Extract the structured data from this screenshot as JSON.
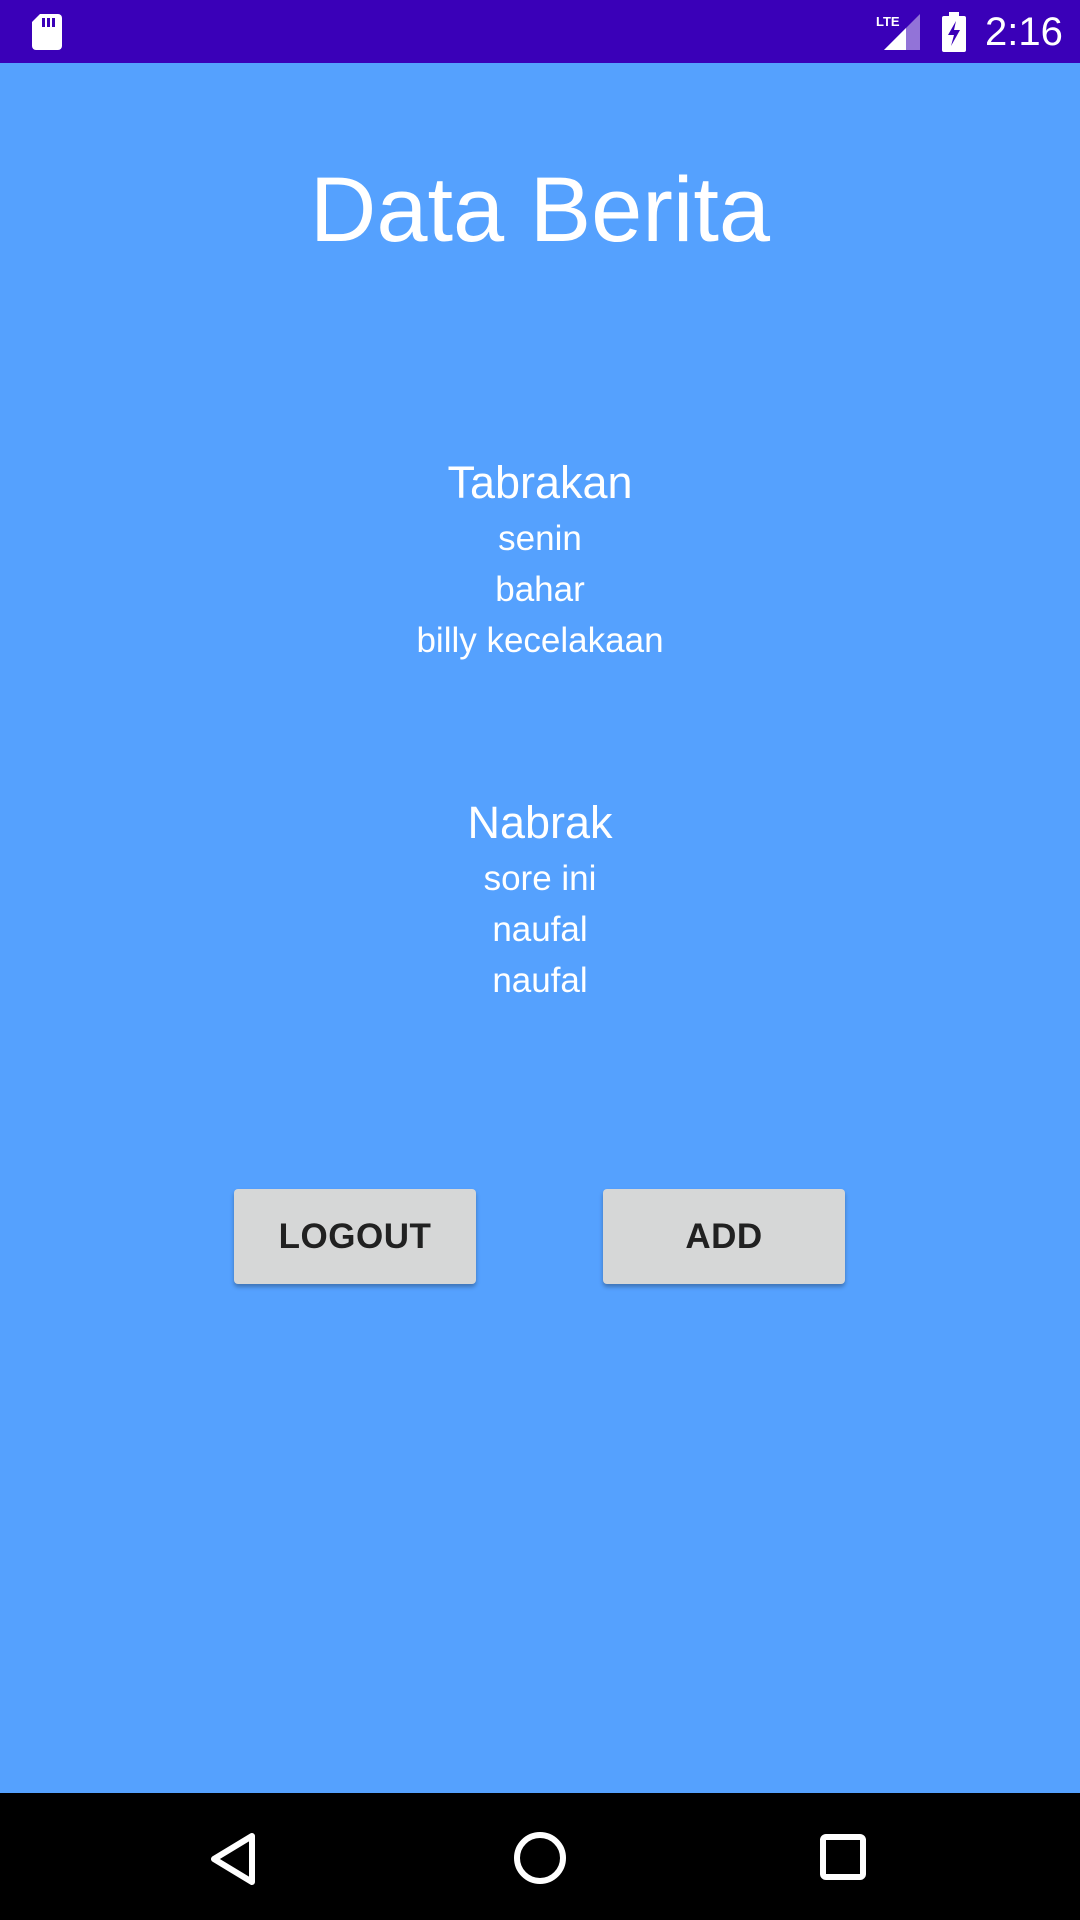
{
  "status_bar": {
    "time": "2:16",
    "network": "LTE",
    "icons": [
      "sd-card-icon",
      "lte-signal-icon",
      "battery-charging-icon"
    ]
  },
  "page": {
    "title": "Data Berita"
  },
  "news": [
    {
      "title": "Tabrakan",
      "lines": [
        "senin",
        "bahar",
        "billy kecelakaan"
      ]
    },
    {
      "title": "Nabrak",
      "lines": [
        "sore ini",
        "naufal",
        "naufal"
      ]
    }
  ],
  "buttons": {
    "logout_label": "LOGOUT",
    "add_label": "ADD"
  },
  "nav_bar": {
    "icons": [
      "back-icon",
      "home-icon",
      "recents-icon"
    ]
  },
  "colors": {
    "background": "#55a1fe",
    "status_bar": "#3a00b8",
    "button": "#d6d7d7",
    "nav_bar": "#000000"
  }
}
